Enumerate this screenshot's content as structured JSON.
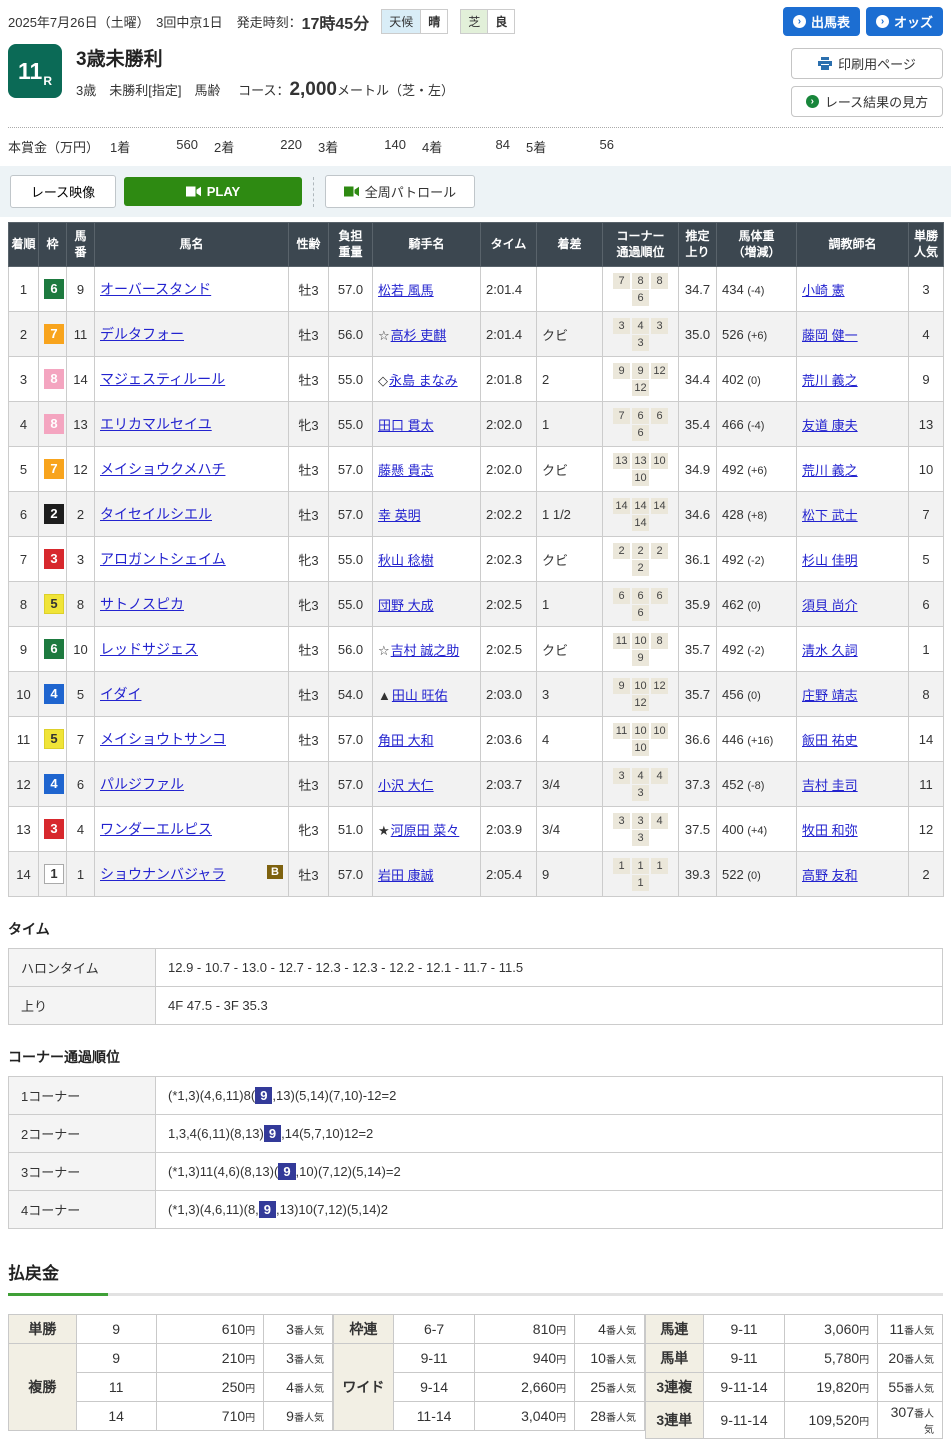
{
  "topbar": {
    "date_text": "2025年7月26日（土曜）　3回中京1日",
    "start_label": "発走時刻：",
    "start_time": "17時45分",
    "weather_label": "天候",
    "weather_value": "晴",
    "turf_label": "芝",
    "turf_value": "良",
    "entry_button": "出馬表",
    "odds_button": "オッズ"
  },
  "race": {
    "number": "11",
    "r_suffix": "R",
    "name": "3歳未勝利",
    "condition": "3歳　未勝利[指定]　馬齢",
    "course_label": "コース：",
    "course_distance": "2,000",
    "course_note": "メートル（芝・左）",
    "print_button": "印刷用ページ",
    "guide_button": "レース結果の見方"
  },
  "prize": {
    "label": "本賞金（万円）",
    "items": [
      {
        "place": "1着",
        "amount": "560"
      },
      {
        "place": "2着",
        "amount": "220"
      },
      {
        "place": "3着",
        "amount": "140"
      },
      {
        "place": "4着",
        "amount": "84"
      },
      {
        "place": "5着",
        "amount": "56"
      }
    ]
  },
  "media": {
    "video_label": "レース映像",
    "play_label": "PLAY",
    "patrol_label": "全周パトロール"
  },
  "frame_colors": {
    "1": {
      "bg": "#ffffff",
      "fg": "#333333",
      "bd": "#aaaaaa"
    },
    "2": {
      "bg": "#1d1d1d",
      "fg": "#ffffff",
      "bd": "#1d1d1d"
    },
    "3": {
      "bg": "#d7282d",
      "fg": "#ffffff",
      "bd": "#d7282d"
    },
    "4": {
      "bg": "#1f65cf",
      "fg": "#ffffff",
      "bd": "#1f65cf"
    },
    "5": {
      "bg": "#f0e438",
      "fg": "#333333",
      "bd": "#ddd02a"
    },
    "6": {
      "bg": "#1d7a3f",
      "fg": "#ffffff",
      "bd": "#1d7a3f"
    },
    "7": {
      "bg": "#f8a41d",
      "fg": "#ffffff",
      "bd": "#f8a41d"
    },
    "8": {
      "bg": "#f4a5c0",
      "fg": "#ffffff",
      "bd": "#f4a5c0"
    }
  },
  "results": {
    "headers": [
      "着順",
      "枠",
      "馬\n番",
      "馬名",
      "性齢",
      "負担\n重量",
      "騎手名",
      "タイム",
      "着差",
      "コーナー\n通過順位",
      "推定\n上り",
      "馬体重\n（増減）",
      "調教師名",
      "単勝\n人気"
    ],
    "rows": [
      {
        "pos": "1",
        "frame": "6",
        "num": "9",
        "horse": "オーバースタンド",
        "badge": "",
        "sex": "牡3",
        "wt": "57.0",
        "jp": "",
        "jockey": "松若 風馬",
        "time": "2:01.4",
        "margin": "",
        "corners": [
          "7",
          "8",
          "8",
          "6"
        ],
        "agari": "34.7",
        "bw": "434",
        "bwd": "(-4)",
        "trainer": "小崎 憲",
        "fav": "3"
      },
      {
        "pos": "2",
        "frame": "7",
        "num": "11",
        "horse": "デルタフォー",
        "badge": "",
        "sex": "牡3",
        "wt": "56.0",
        "jp": "☆",
        "jockey": "高杉 吏麒",
        "time": "2:01.4",
        "margin": "クビ",
        "corners": [
          "3",
          "4",
          "3",
          "3"
        ],
        "agari": "35.0",
        "bw": "526",
        "bwd": "(+6)",
        "trainer": "藤岡 健一",
        "fav": "4"
      },
      {
        "pos": "3",
        "frame": "8",
        "num": "14",
        "horse": "マジェスティルール",
        "badge": "",
        "sex": "牡3",
        "wt": "55.0",
        "jp": "◇",
        "jockey": "永島 まなみ",
        "time": "2:01.8",
        "margin": "2",
        "corners": [
          "9",
          "9",
          "12",
          "12"
        ],
        "agari": "34.4",
        "bw": "402",
        "bwd": "(0)",
        "trainer": "荒川 義之",
        "fav": "9"
      },
      {
        "pos": "4",
        "frame": "8",
        "num": "13",
        "horse": "エリカマルセイユ",
        "badge": "",
        "sex": "牝3",
        "wt": "55.0",
        "jp": "",
        "jockey": "田口 貫太",
        "time": "2:02.0",
        "margin": "1",
        "corners": [
          "7",
          "6",
          "6",
          "6"
        ],
        "agari": "35.4",
        "bw": "466",
        "bwd": "(-4)",
        "trainer": "友道 康夫",
        "fav": "13"
      },
      {
        "pos": "5",
        "frame": "7",
        "num": "12",
        "horse": "メイショウクメハチ",
        "badge": "",
        "sex": "牡3",
        "wt": "57.0",
        "jp": "",
        "jockey": "藤懸 貴志",
        "time": "2:02.0",
        "margin": "クビ",
        "corners": [
          "13",
          "13",
          "10",
          "10"
        ],
        "agari": "34.9",
        "bw": "492",
        "bwd": "(+6)",
        "trainer": "荒川 義之",
        "fav": "10"
      },
      {
        "pos": "6",
        "frame": "2",
        "num": "2",
        "horse": "タイセイルシエル",
        "badge": "",
        "sex": "牡3",
        "wt": "57.0",
        "jp": "",
        "jockey": "幸 英明",
        "time": "2:02.2",
        "margin": "1 1/2",
        "corners": [
          "14",
          "14",
          "14",
          "14"
        ],
        "agari": "34.6",
        "bw": "428",
        "bwd": "(+8)",
        "trainer": "松下 武士",
        "fav": "7"
      },
      {
        "pos": "7",
        "frame": "3",
        "num": "3",
        "horse": "アロガントシェイム",
        "badge": "",
        "sex": "牝3",
        "wt": "55.0",
        "jp": "",
        "jockey": "秋山 稔樹",
        "time": "2:02.3",
        "margin": "クビ",
        "corners": [
          "2",
          "2",
          "2",
          "2"
        ],
        "agari": "36.1",
        "bw": "492",
        "bwd": "(-2)",
        "trainer": "杉山 佳明",
        "fav": "5"
      },
      {
        "pos": "8",
        "frame": "5",
        "num": "8",
        "horse": "サトノスピカ",
        "badge": "",
        "sex": "牝3",
        "wt": "55.0",
        "jp": "",
        "jockey": "団野 大成",
        "time": "2:02.5",
        "margin": "1",
        "corners": [
          "6",
          "6",
          "6",
          "6"
        ],
        "agari": "35.9",
        "bw": "462",
        "bwd": "(0)",
        "trainer": "須貝 尚介",
        "fav": "6"
      },
      {
        "pos": "9",
        "frame": "6",
        "num": "10",
        "horse": "レッドサジェス",
        "badge": "",
        "sex": "牡3",
        "wt": "56.0",
        "jp": "☆",
        "jockey": "吉村 誠之助",
        "time": "2:02.5",
        "margin": "クビ",
        "corners": [
          "11",
          "10",
          "8",
          "9"
        ],
        "agari": "35.7",
        "bw": "492",
        "bwd": "(-2)",
        "trainer": "清水 久詞",
        "fav": "1"
      },
      {
        "pos": "10",
        "frame": "4",
        "num": "5",
        "horse": "イダイ",
        "badge": "",
        "sex": "牡3",
        "wt": "54.0",
        "jp": "▲",
        "jockey": "田山 旺佑",
        "time": "2:03.0",
        "margin": "3",
        "corners": [
          "9",
          "10",
          "12",
          "12"
        ],
        "agari": "35.7",
        "bw": "456",
        "bwd": "(0)",
        "trainer": "庄野 靖志",
        "fav": "8"
      },
      {
        "pos": "11",
        "frame": "5",
        "num": "7",
        "horse": "メイショウトサンコ",
        "badge": "",
        "sex": "牡3",
        "wt": "57.0",
        "jp": "",
        "jockey": "角田 大和",
        "time": "2:03.6",
        "margin": "4",
        "corners": [
          "11",
          "10",
          "10",
          "10"
        ],
        "agari": "36.6",
        "bw": "446",
        "bwd": "(+16)",
        "trainer": "飯田 祐史",
        "fav": "14"
      },
      {
        "pos": "12",
        "frame": "4",
        "num": "6",
        "horse": "パルジファル",
        "badge": "",
        "sex": "牡3",
        "wt": "57.0",
        "jp": "",
        "jockey": "小沢 大仁",
        "time": "2:03.7",
        "margin": "3/4",
        "corners": [
          "3",
          "4",
          "4",
          "3"
        ],
        "agari": "37.3",
        "bw": "452",
        "bwd": "(-8)",
        "trainer": "吉村 圭司",
        "fav": "11"
      },
      {
        "pos": "13",
        "frame": "3",
        "num": "4",
        "horse": "ワンダーエルピス",
        "badge": "",
        "sex": "牝3",
        "wt": "51.0",
        "jp": "★",
        "jockey": "河原田 菜々",
        "time": "2:03.9",
        "margin": "3/4",
        "corners": [
          "3",
          "3",
          "4",
          "3"
        ],
        "agari": "37.5",
        "bw": "400",
        "bwd": "(+4)",
        "trainer": "牧田 和弥",
        "fav": "12"
      },
      {
        "pos": "14",
        "frame": "1",
        "num": "1",
        "horse": "ショウナンバジャラ",
        "badge": "B",
        "sex": "牡3",
        "wt": "57.0",
        "jp": "",
        "jockey": "岩田 康誠",
        "time": "2:05.4",
        "margin": "9",
        "corners": [
          "1",
          "1",
          "1",
          "1"
        ],
        "agari": "39.3",
        "bw": "522",
        "bwd": "(0)",
        "trainer": "高野 友和",
        "fav": "2"
      }
    ]
  },
  "time_section": {
    "title": "タイム",
    "halon_label": "ハロンタイム",
    "halon_value": "12.9 - 10.7 - 13.0 - 12.7 - 12.3 - 12.3 - 12.2 - 12.1 - 11.7 - 11.5",
    "agari_label": "上り",
    "agari_value": "4F 47.5 - 3F 35.3"
  },
  "corner_section": {
    "title": "コーナー通過順位",
    "rows": [
      {
        "label": "1コーナー",
        "pre": "(*1,3)(4,6,11)8(",
        "hl": "9",
        "post": ",13)(5,14)(7,10)-12=2"
      },
      {
        "label": "2コーナー",
        "pre": "1,3,4(6,11)(8,13)",
        "hl": "9",
        "post": ",14(5,7,10)12=2"
      },
      {
        "label": "3コーナー",
        "pre": "(*1,3)11(4,6)(8,13)(",
        "hl": "9",
        "post": ",10)(7,12)(5,14)=2"
      },
      {
        "label": "4コーナー",
        "pre": "(*1,3)(4,6,11)(8,",
        "hl": "9",
        "post": ",13)10(7,12)(5,14)2"
      }
    ]
  },
  "payout": {
    "title": "払戻金",
    "yen_suffix": "円",
    "fav_suffix": "番人気",
    "groups": [
      {
        "widths": [
          68,
          80,
          108,
          69
        ],
        "blocks": [
          {
            "label": "単勝",
            "rows": [
              {
                "sel": "9",
                "amount": "610",
                "fav": "3"
              }
            ]
          },
          {
            "label": "複勝",
            "rows": [
              {
                "sel": "9",
                "amount": "210",
                "fav": "3"
              },
              {
                "sel": "11",
                "amount": "250",
                "fav": "4"
              },
              {
                "sel": "14",
                "amount": "710",
                "fav": "9"
              }
            ]
          }
        ]
      },
      {
        "widths": [
          60,
          82,
          100,
          70
        ],
        "blocks": [
          {
            "label": "枠連",
            "rows": [
              {
                "sel": "6-7",
                "amount": "810",
                "fav": "4"
              }
            ]
          },
          {
            "label": "ワイド",
            "rows": [
              {
                "sel": "9-11",
                "amount": "940",
                "fav": "10"
              },
              {
                "sel": "9-14",
                "amount": "2,660",
                "fav": "25"
              },
              {
                "sel": "11-14",
                "amount": "3,040",
                "fav": "28"
              }
            ]
          }
        ]
      },
      {
        "widths": [
          58,
          82,
          93,
          65
        ],
        "blocks": [
          {
            "label": "馬連",
            "rows": [
              {
                "sel": "9-11",
                "amount": "3,060",
                "fav": "11"
              }
            ]
          },
          {
            "label": "馬単",
            "rows": [
              {
                "sel": "9-11",
                "amount": "5,780",
                "fav": "20"
              }
            ]
          },
          {
            "label": "3連複",
            "rows": [
              {
                "sel": "9-11-14",
                "amount": "19,820",
                "fav": "55"
              }
            ]
          },
          {
            "label": "3連単",
            "rows": [
              {
                "sel": "9-11-14",
                "amount": "109,520",
                "fav": "307"
              }
            ]
          }
        ]
      }
    ]
  },
  "colors": {
    "accent_blue": "#1c6ed2",
    "play_green": "#2e8a12",
    "race_badge_green": "#0b6a56",
    "table_header": "#3c4750",
    "corner_highlight": "#333a99",
    "link_blue": "#2323cf",
    "payout_label_bg": "#f2efe4",
    "band_bg": "#edf3f6"
  }
}
